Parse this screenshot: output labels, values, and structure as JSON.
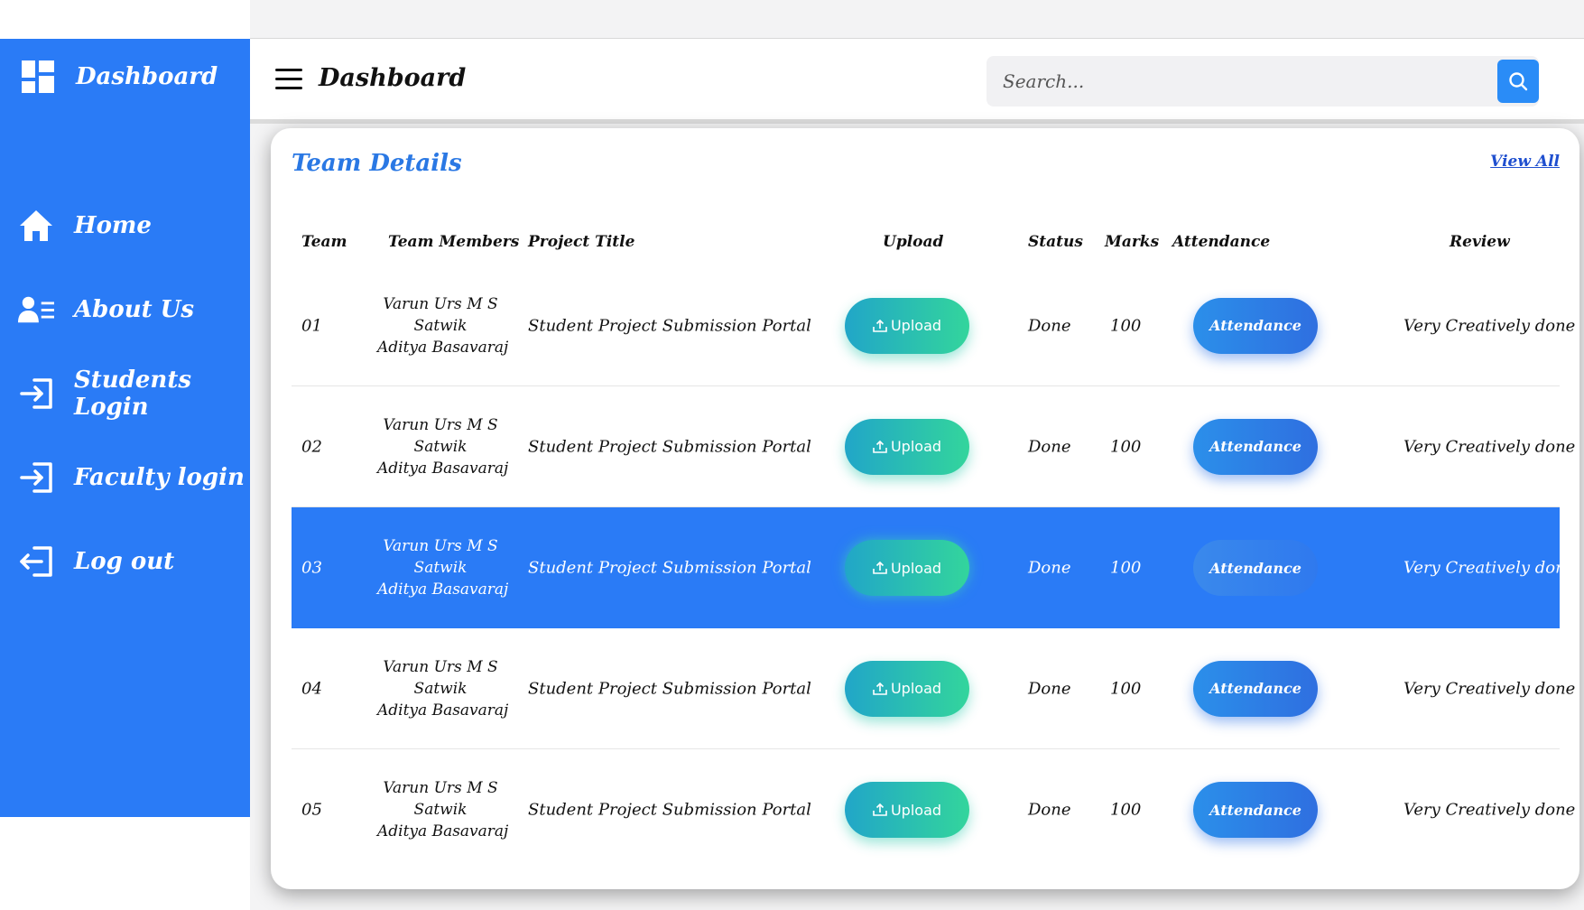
{
  "sidebar": {
    "brand": "Dashboard",
    "items": [
      {
        "label": "Home",
        "icon": "home-icon"
      },
      {
        "label": "About Us",
        "icon": "user-list-icon"
      },
      {
        "label": "Students Login",
        "icon": "login-icon"
      },
      {
        "label": "Faculty login",
        "icon": "login-icon"
      },
      {
        "label": "Log out",
        "icon": "logout-icon"
      }
    ]
  },
  "header": {
    "title": "Dashboard",
    "search_placeholder": "Search..."
  },
  "colors": {
    "primary": "#2a7bf6",
    "title_blue": "#2a78e4",
    "upload_gradient": [
      "#21a6c8",
      "#33d59c"
    ],
    "attendance_gradient": [
      "#2b8fea",
      "#2f6fe0"
    ]
  },
  "card": {
    "title": "Team Details",
    "view_all": "View All",
    "columns": {
      "team": "Team",
      "members": "Team Members",
      "project": "Project Title",
      "upload": "Upload",
      "status": "Status",
      "marks": "Marks",
      "attendance": "Attendance",
      "review": "Review"
    },
    "rows": [
      {
        "team": "01",
        "members": [
          "Varun Urs M S",
          "Satwik",
          "Aditya Basavaraj"
        ],
        "project": "Student Project Submission Portal",
        "upload": "Upload",
        "status": "Done",
        "marks": "100",
        "attendance": "Attendance",
        "review": "Very Creatively done"
      },
      {
        "team": "02",
        "members": [
          "Varun Urs M S",
          "Satwik",
          "Aditya Basavaraj"
        ],
        "project": "Student Project Submission Portal",
        "upload": "Upload",
        "status": "Done",
        "marks": "100",
        "attendance": "Attendance",
        "review": "Very Creatively done"
      },
      {
        "team": "03",
        "members": [
          "Varun Urs M S",
          "Satwik",
          "Aditya Basavaraj"
        ],
        "project": "Student Project Submission Portal",
        "upload": "Upload",
        "status": "Done",
        "marks": "100",
        "attendance": "Attendance",
        "review": "Very Creatively done"
      },
      {
        "team": "04",
        "members": [
          "Varun Urs M S",
          "Satwik",
          "Aditya Basavaraj"
        ],
        "project": "Student Project Submission Portal",
        "upload": "Upload",
        "status": "Done",
        "marks": "100",
        "attendance": "Attendance",
        "review": "Very Creatively done"
      },
      {
        "team": "05",
        "members": [
          "Varun Urs M S",
          "Satwik",
          "Aditya Basavaraj"
        ],
        "project": "Student Project Submission Portal",
        "upload": "Upload",
        "status": "Done",
        "marks": "100",
        "attendance": "Attendance",
        "review": "Very Creatively done"
      }
    ]
  }
}
